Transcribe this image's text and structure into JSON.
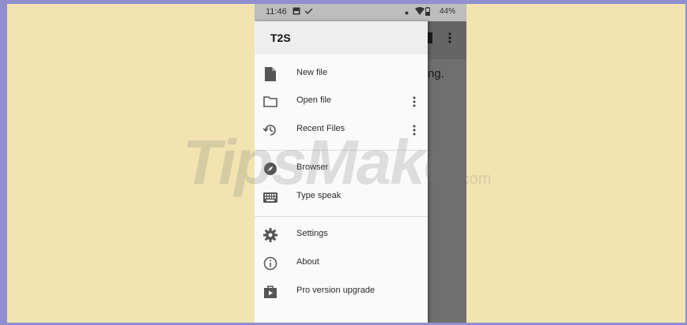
{
  "status_bar": {
    "time": "11:46",
    "battery": "44%",
    "icons": [
      "image-icon",
      "check-icon",
      "dot-icon",
      "wifi-icon",
      "battery-icon"
    ]
  },
  "app_behind": {
    "peek_text": "ng.",
    "toolbar_icons": [
      "trash-icon",
      "more-vert-icon"
    ]
  },
  "drawer": {
    "title": "T2S",
    "items": [
      {
        "label": "New file",
        "icon": "file-icon",
        "has_more": false
      },
      {
        "label": "Open file",
        "icon": "folder-icon",
        "has_more": true
      },
      {
        "label": "Recent Files",
        "icon": "history-icon",
        "has_more": true
      },
      {
        "label": "Browser",
        "icon": "compass-icon",
        "has_more": false
      },
      {
        "label": "Type speak",
        "icon": "keyboard-icon",
        "has_more": false
      },
      {
        "label": "Settings",
        "icon": "gear-icon",
        "has_more": false
      },
      {
        "label": "About",
        "icon": "info-icon",
        "has_more": false
      },
      {
        "label": "Pro version upgrade",
        "icon": "shop-icon",
        "has_more": false
      }
    ]
  },
  "watermark": {
    "text": "TipsMake",
    "suffix": ".com"
  },
  "colors": {
    "frame_border": "#8f8fd0",
    "background": "#f1e4b1",
    "drawer": "#fafafa",
    "scrim": "#7b7b7b"
  }
}
